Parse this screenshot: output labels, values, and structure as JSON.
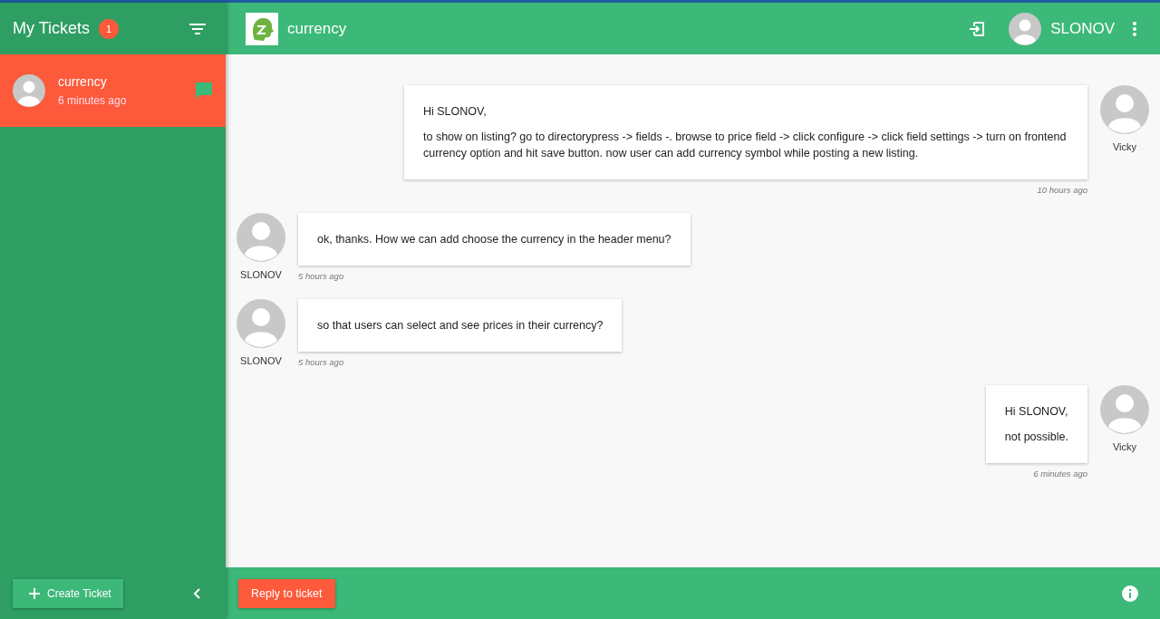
{
  "sidebar": {
    "title": "My Tickets",
    "badge": "1",
    "tickets": [
      {
        "title": "currency",
        "time": "6 minutes ago",
        "selected": true
      }
    ],
    "create_button": "Create Ticket"
  },
  "header": {
    "title": "currency",
    "user": "SLONOV"
  },
  "messages": [
    {
      "kind": "outgoing",
      "author": "Vicky",
      "time": "10 hours ago",
      "paragraphs": [
        "Hi SLONOV,",
        "to show on listing? go to directorypress -> fields -. browse to price field -> click configure -> click field settings -> turn on frontend currency option and hit save button. now user can add currency symbol while posting a new listing."
      ]
    },
    {
      "kind": "incoming",
      "author": "SLONOV",
      "time": "5 hours ago",
      "paragraphs": [
        "ok, thanks. How we can add choose the currency in the header menu?"
      ]
    },
    {
      "kind": "incoming",
      "author": "SLONOV",
      "time": "5 hours ago",
      "paragraphs": [
        "so that users can select and see prices in their currency?"
      ]
    },
    {
      "kind": "outgoing",
      "author": "Vicky",
      "time": "6 minutes ago",
      "paragraphs": [
        "Hi SLONOV,",
        "not possible."
      ]
    }
  ],
  "footer": {
    "reply_button": "Reply to ticket"
  }
}
